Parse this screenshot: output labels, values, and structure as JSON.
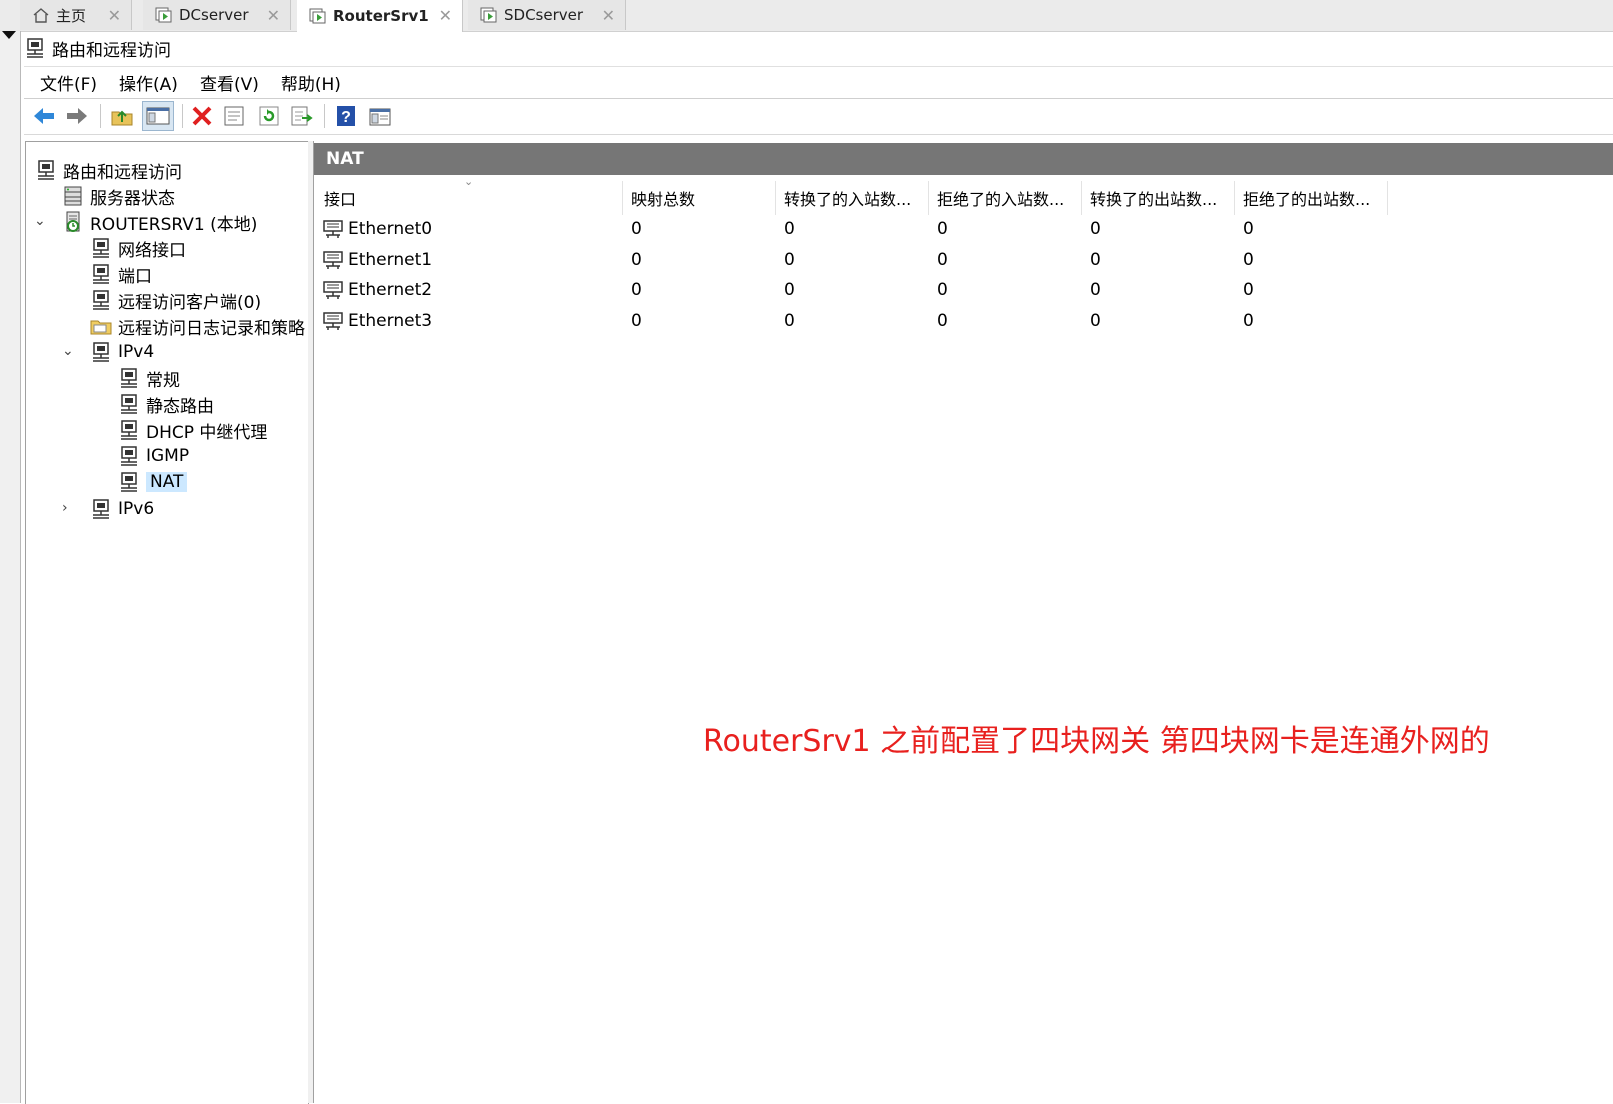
{
  "tabs": [
    {
      "label": "主页",
      "icon": "home-icon",
      "active": false
    },
    {
      "label": "DCserver",
      "icon": "vm-icon",
      "active": false
    },
    {
      "label": "RouterSrv1",
      "icon": "vm-icon",
      "active": true
    },
    {
      "label": "SDCserver",
      "icon": "vm-icon",
      "active": false
    }
  ],
  "window": {
    "title": "路由和远程访问"
  },
  "menu": [
    "文件(F)",
    "操作(A)",
    "查看(V)",
    "帮助(H)"
  ],
  "toolbar": [
    "back-icon",
    "forward-icon",
    "up-folder-icon",
    "show-hide-tree-icon",
    "delete-icon",
    "properties-icon",
    "refresh-icon",
    "export-list-icon",
    "help-icon",
    "mmc-view-icon"
  ],
  "tree": [
    {
      "label": "路由和远程访问",
      "icon": "rras-icon"
    },
    {
      "label": "服务器状态",
      "icon": "server-status-icon"
    },
    {
      "label": "ROUTERSRV1 (本地)",
      "icon": "server-icon"
    },
    {
      "label": "网络接口",
      "icon": "network-icon"
    },
    {
      "label": "端口",
      "icon": "network-icon"
    },
    {
      "label": "远程访问客户端(0)",
      "icon": "network-icon"
    },
    {
      "label": "远程访问日志记录和策略",
      "icon": "folder-icon"
    },
    {
      "label": "IPv4",
      "icon": "network-icon"
    },
    {
      "label": "常规",
      "icon": "network-icon"
    },
    {
      "label": "静态路由",
      "icon": "network-icon"
    },
    {
      "label": "DHCP 中继代理",
      "icon": "network-icon"
    },
    {
      "label": "IGMP",
      "icon": "network-icon"
    },
    {
      "label": "NAT",
      "icon": "network-icon",
      "selected": true
    },
    {
      "label": "IPv6",
      "icon": "network-icon"
    }
  ],
  "panel": {
    "title": "NAT"
  },
  "columns": [
    "接口",
    "映射总数",
    "转换了的入站数...",
    "拒绝了的入站数...",
    "转换了的出站数...",
    "拒绝了的出站数..."
  ],
  "rows": [
    {
      "interface": "Ethernet0",
      "values": [
        "0",
        "0",
        "0",
        "0",
        "0"
      ]
    },
    {
      "interface": "Ethernet1",
      "values": [
        "0",
        "0",
        "0",
        "0",
        "0"
      ]
    },
    {
      "interface": "Ethernet2",
      "values": [
        "0",
        "0",
        "0",
        "0",
        "0"
      ]
    },
    {
      "interface": "Ethernet3",
      "values": [
        "0",
        "0",
        "0",
        "0",
        "0"
      ]
    }
  ],
  "annotation": "RouterSrv1 之前配置了四块网关 第四块网卡是连通外网的",
  "colors": {
    "header_bar": "#767676",
    "selection": "#cce8ff",
    "annotation": "#e8201e"
  }
}
